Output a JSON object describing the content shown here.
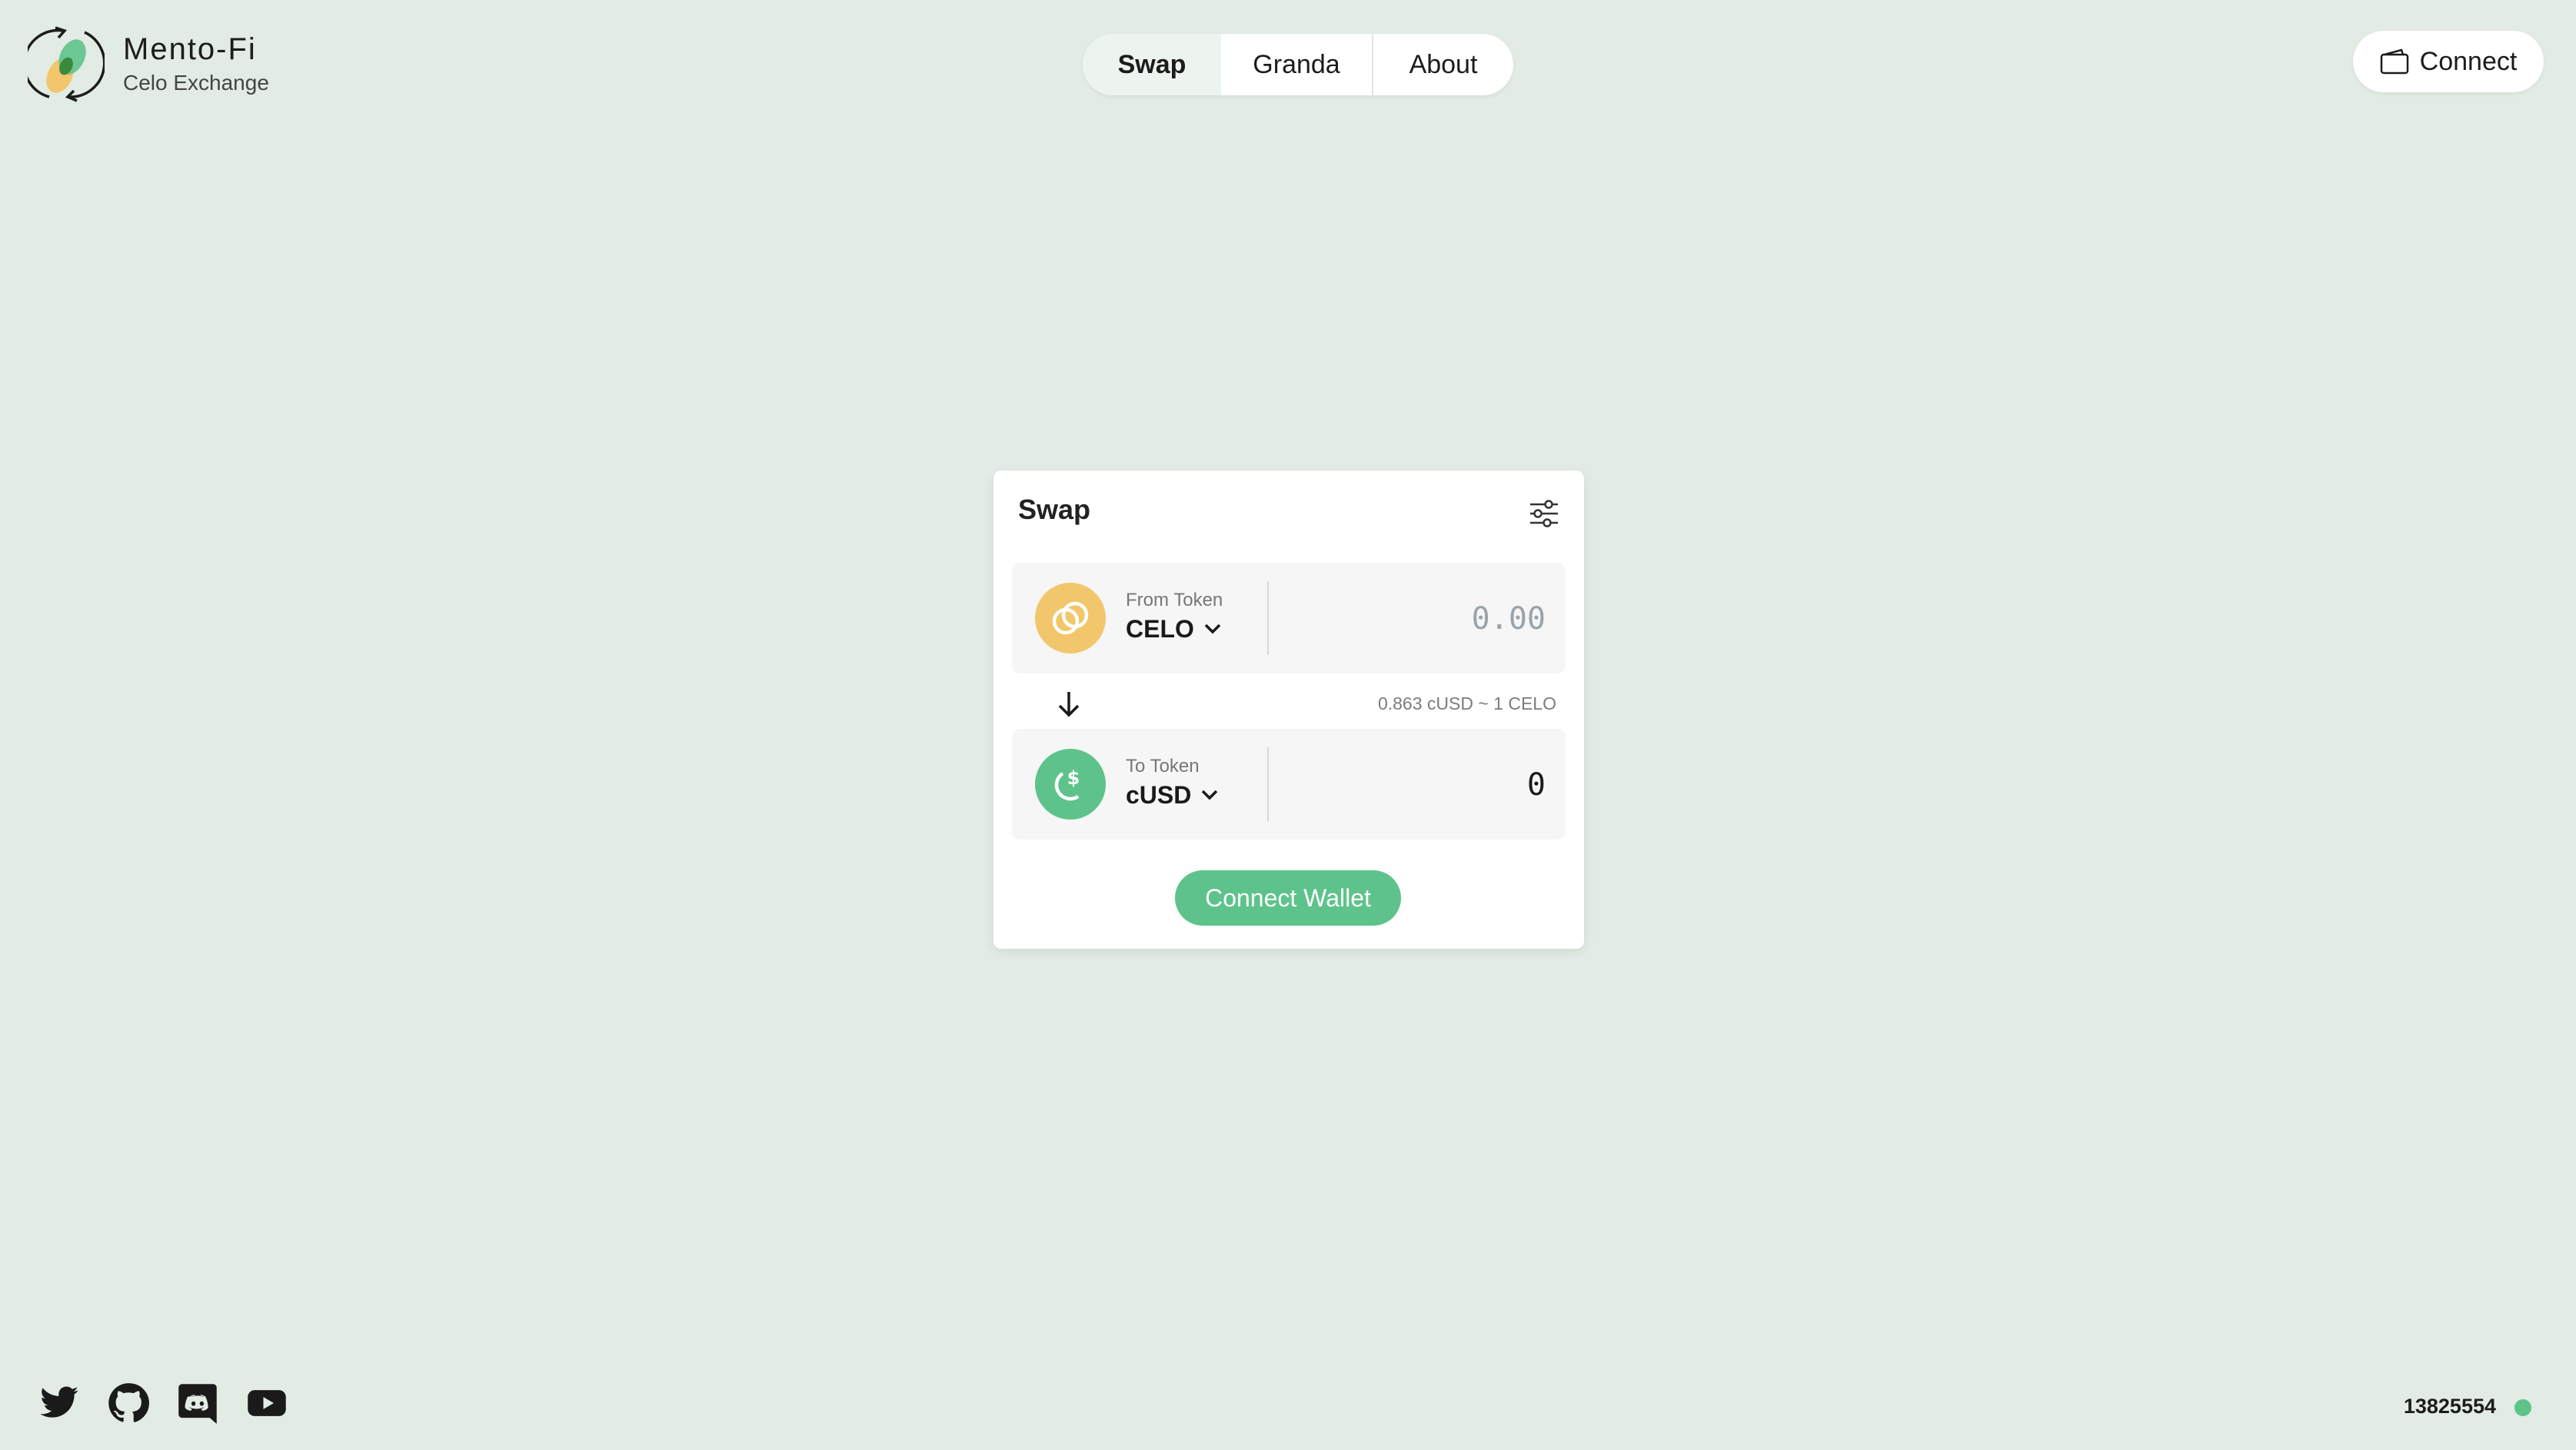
{
  "brand": {
    "name": "Mento-Fi",
    "subtitle": "Celo Exchange"
  },
  "nav": {
    "tabs": [
      {
        "label": "Swap",
        "active": true
      },
      {
        "label": "Granda",
        "active": false
      },
      {
        "label": "About",
        "active": false
      }
    ]
  },
  "header": {
    "connect_label": "Connect",
    "connect_icon": "wallet-icon"
  },
  "swap": {
    "title": "Swap",
    "settings_icon": "sliders-icon",
    "from": {
      "caption": "From Token",
      "token": "CELO",
      "placeholder": "0.00",
      "icon": "celo-token-icon"
    },
    "to": {
      "caption": "To Token",
      "token": "cUSD",
      "value": "0",
      "icon": "cusd-token-icon"
    },
    "rate": "0.863 cUSD ~ 1 CELO",
    "direction_icon": "arrow-down-icon",
    "action_label": "Connect Wallet"
  },
  "footer": {
    "socials": [
      "twitter-icon",
      "github-icon",
      "discord-icon",
      "youtube-icon"
    ],
    "block_number": "13825554",
    "status": "connected"
  },
  "colors": {
    "background": "#e2ebe4",
    "accent_green": "#5ec38a",
    "celo_yellow": "#f2c66a",
    "status_dot": "#5ec38a"
  }
}
